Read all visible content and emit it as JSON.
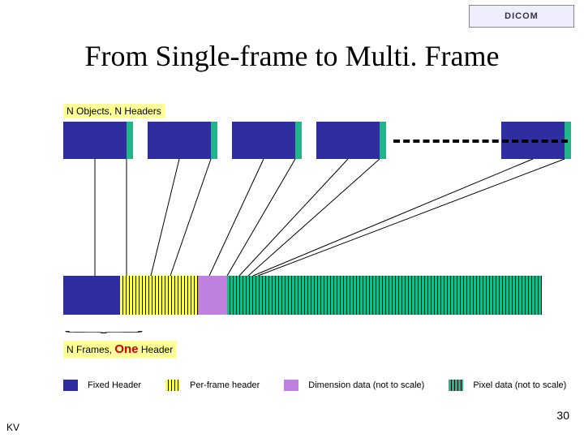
{
  "logo": {
    "text": "DICOM"
  },
  "title": "From Single-frame to Multi. Frame",
  "topLabel": "N Objects, N Headers",
  "bottomLabel": {
    "prefix": "N Frames, ",
    "emph": "One",
    "suffix": " Header"
  },
  "legend": {
    "fixed": "Fixed Header",
    "perframe": "Per-frame header",
    "dimension": "Dimension data (not to scale)",
    "pixel": "Pixel data (not to scale)"
  },
  "pageNumber": "30",
  "footerInitials": "KV"
}
